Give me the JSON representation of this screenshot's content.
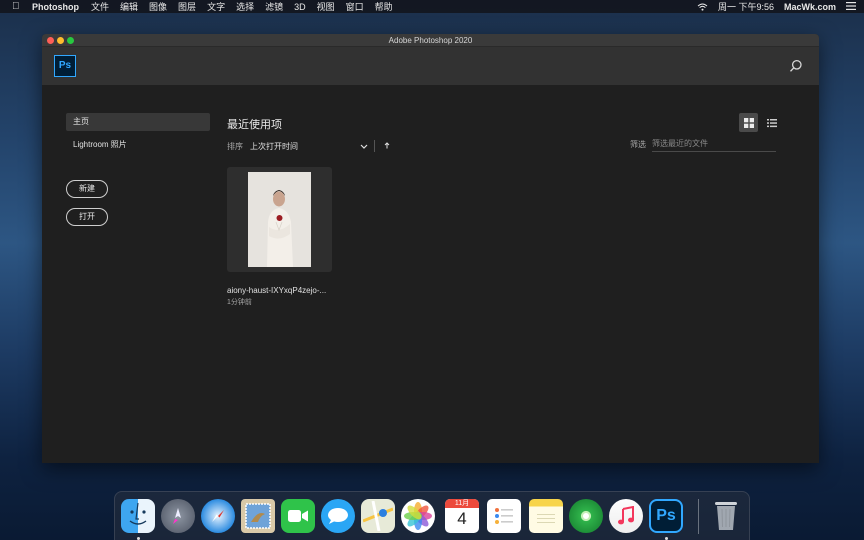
{
  "menubar": {
    "app_name": "Photoshop",
    "items": [
      "文件",
      "编辑",
      "图像",
      "图层",
      "文字",
      "选择",
      "滤镜",
      "3D",
      "视图",
      "窗口",
      "帮助"
    ],
    "clock": "周一 下午9:56",
    "brand": "MacWk.com"
  },
  "window": {
    "title": "Adobe Photoshop 2020",
    "logo_text": "Ps"
  },
  "sidebar": {
    "items": [
      {
        "label": "主页",
        "active": true
      },
      {
        "label": "Lightroom 照片",
        "active": false
      }
    ],
    "new_button": "新建",
    "open_button": "打开"
  },
  "main": {
    "title": "最近使用项",
    "sort_label": "排序",
    "sort_value": "上次打开时间",
    "filter_label": "筛选",
    "filter_placeholder": "筛选最近的文件"
  },
  "recent_files": [
    {
      "name": "aiony-haust-IXYxqP4zejo-...",
      "time": "1分钟前"
    }
  ],
  "dock": {
    "apps": [
      "finder",
      "launchpad",
      "safari",
      "mail",
      "facetime",
      "messages",
      "maps",
      "photos",
      "calendar",
      "reminders",
      "notes",
      "find-my",
      "music",
      "photoshop",
      "trash"
    ],
    "calendar_month": "11月",
    "calendar_day": "4",
    "photoshop_label": "Ps"
  },
  "colors": {
    "ps_blue": "#31a8ff",
    "ps_navy": "#001e36",
    "window_bg": "#1f1f1f",
    "header_bg": "#323232"
  }
}
